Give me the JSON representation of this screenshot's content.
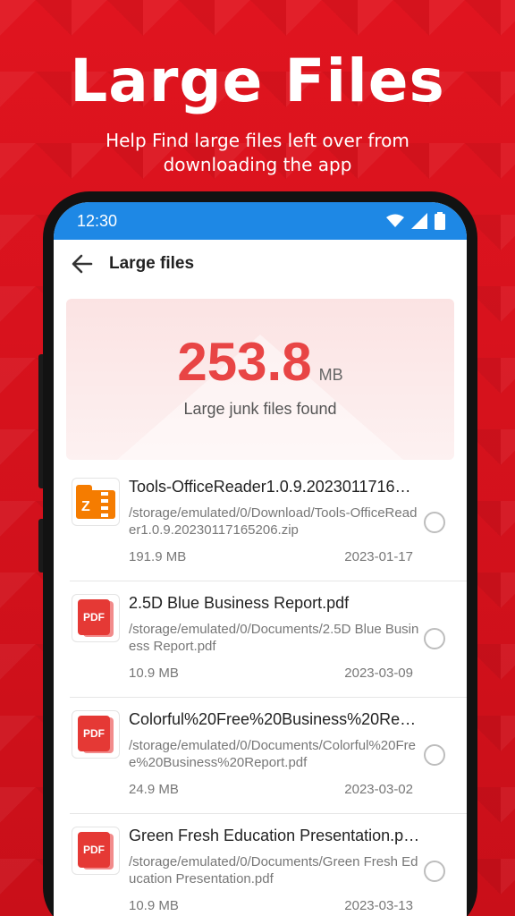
{
  "promo": {
    "title": "Large Files",
    "subtitle": "Help Find large files left over from downloading the app"
  },
  "status_bar": {
    "time": "12:30",
    "icons": [
      "wifi-icon",
      "signal-icon",
      "battery-icon"
    ]
  },
  "app_bar": {
    "title": "Large files",
    "back_icon": "arrow-left-icon"
  },
  "summary": {
    "value": "253.8",
    "unit": "MB",
    "label": "Large junk files found"
  },
  "files": [
    {
      "type": "zip",
      "icon_text": "Z",
      "name": "Tools-OfficeReader1.0.9.2023011716…",
      "path": "/storage/emulated/0/Download/Tools-OfficeReader1.0.9.20230117165206.zip",
      "size": "191.9 MB",
      "date": "2023-01-17",
      "selected": false
    },
    {
      "type": "pdf",
      "icon_text": "PDF",
      "name": "2.5D Blue Business Report.pdf",
      "path": "/storage/emulated/0/Documents/2.5D Blue Business Report.pdf",
      "size": "10.9 MB",
      "date": "2023-03-09",
      "selected": false
    },
    {
      "type": "pdf",
      "icon_text": "PDF",
      "name": "Colorful%20Free%20Business%20Rep…",
      "path": "/storage/emulated/0/Documents/Colorful%20Free%20Business%20Report.pdf",
      "size": "24.9 MB",
      "date": "2023-03-02",
      "selected": false
    },
    {
      "type": "pdf",
      "icon_text": "PDF",
      "name": "Green Fresh Education Presentation.p…",
      "path": "/storage/emulated/0/Documents/Green Fresh Education Presentation.pdf",
      "size": "10.9 MB",
      "date": "2023-03-13",
      "selected": false
    }
  ],
  "colors": {
    "background": "#d8121c",
    "statusbar": "#1e88e5",
    "accent_value": "#e84545",
    "pdf_red": "#e53935",
    "zip_orange": "#f57c00"
  }
}
